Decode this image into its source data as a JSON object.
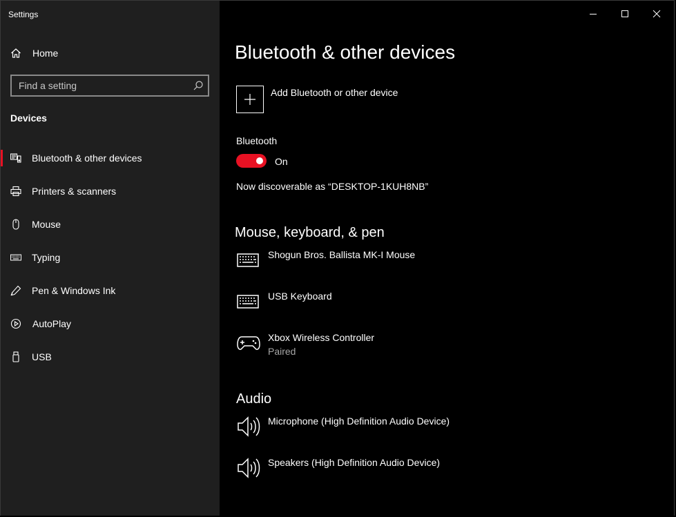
{
  "window": {
    "title": "Settings",
    "minimize_label": "Minimize",
    "maximize_label": "Maximize",
    "close_label": "Close"
  },
  "sidebar": {
    "home_label": "Home",
    "search_placeholder": "Find a setting",
    "section_title": "Devices",
    "items": [
      {
        "label": "Bluetooth & other devices",
        "icon": "bluetooth-devices-icon",
        "active": true
      },
      {
        "label": "Printers & scanners",
        "icon": "printer-icon",
        "active": false
      },
      {
        "label": "Mouse",
        "icon": "mouse-icon",
        "active": false
      },
      {
        "label": "Typing",
        "icon": "keyboard-icon",
        "active": false
      },
      {
        "label": "Pen & Windows Ink",
        "icon": "pen-icon",
        "active": false
      },
      {
        "label": "AutoPlay",
        "icon": "autoplay-icon",
        "active": false
      },
      {
        "label": "USB",
        "icon": "usb-icon",
        "active": false
      }
    ]
  },
  "main": {
    "title": "Bluetooth & other devices",
    "add_device_label": "Add Bluetooth or other device",
    "bluetooth": {
      "label": "Bluetooth",
      "state_text": "On",
      "on": true,
      "discoverable_text": "Now discoverable as “DESKTOP-1KUH8NB”"
    },
    "mouse_keyboard_pen": {
      "title": "Mouse, keyboard, & pen",
      "devices": [
        {
          "name": "Shogun Bros. Ballista MK-I Mouse",
          "status": "",
          "icon": "keyboard-icon"
        },
        {
          "name": "USB Keyboard",
          "status": "",
          "icon": "keyboard-icon"
        },
        {
          "name": "Xbox Wireless Controller",
          "status": "Paired",
          "icon": "gamepad-icon"
        }
      ]
    },
    "audio": {
      "title": "Audio",
      "devices": [
        {
          "name": "Microphone (High Definition Audio Device)",
          "icon": "speaker-icon"
        },
        {
          "name": "Speakers (High Definition Audio Device)",
          "icon": "speaker-icon"
        }
      ]
    }
  },
  "colors": {
    "accent": "#e81123",
    "sidebar_bg": "#1f1f1f",
    "main_bg": "#000000",
    "secondary_text": "#a6a6a6"
  }
}
